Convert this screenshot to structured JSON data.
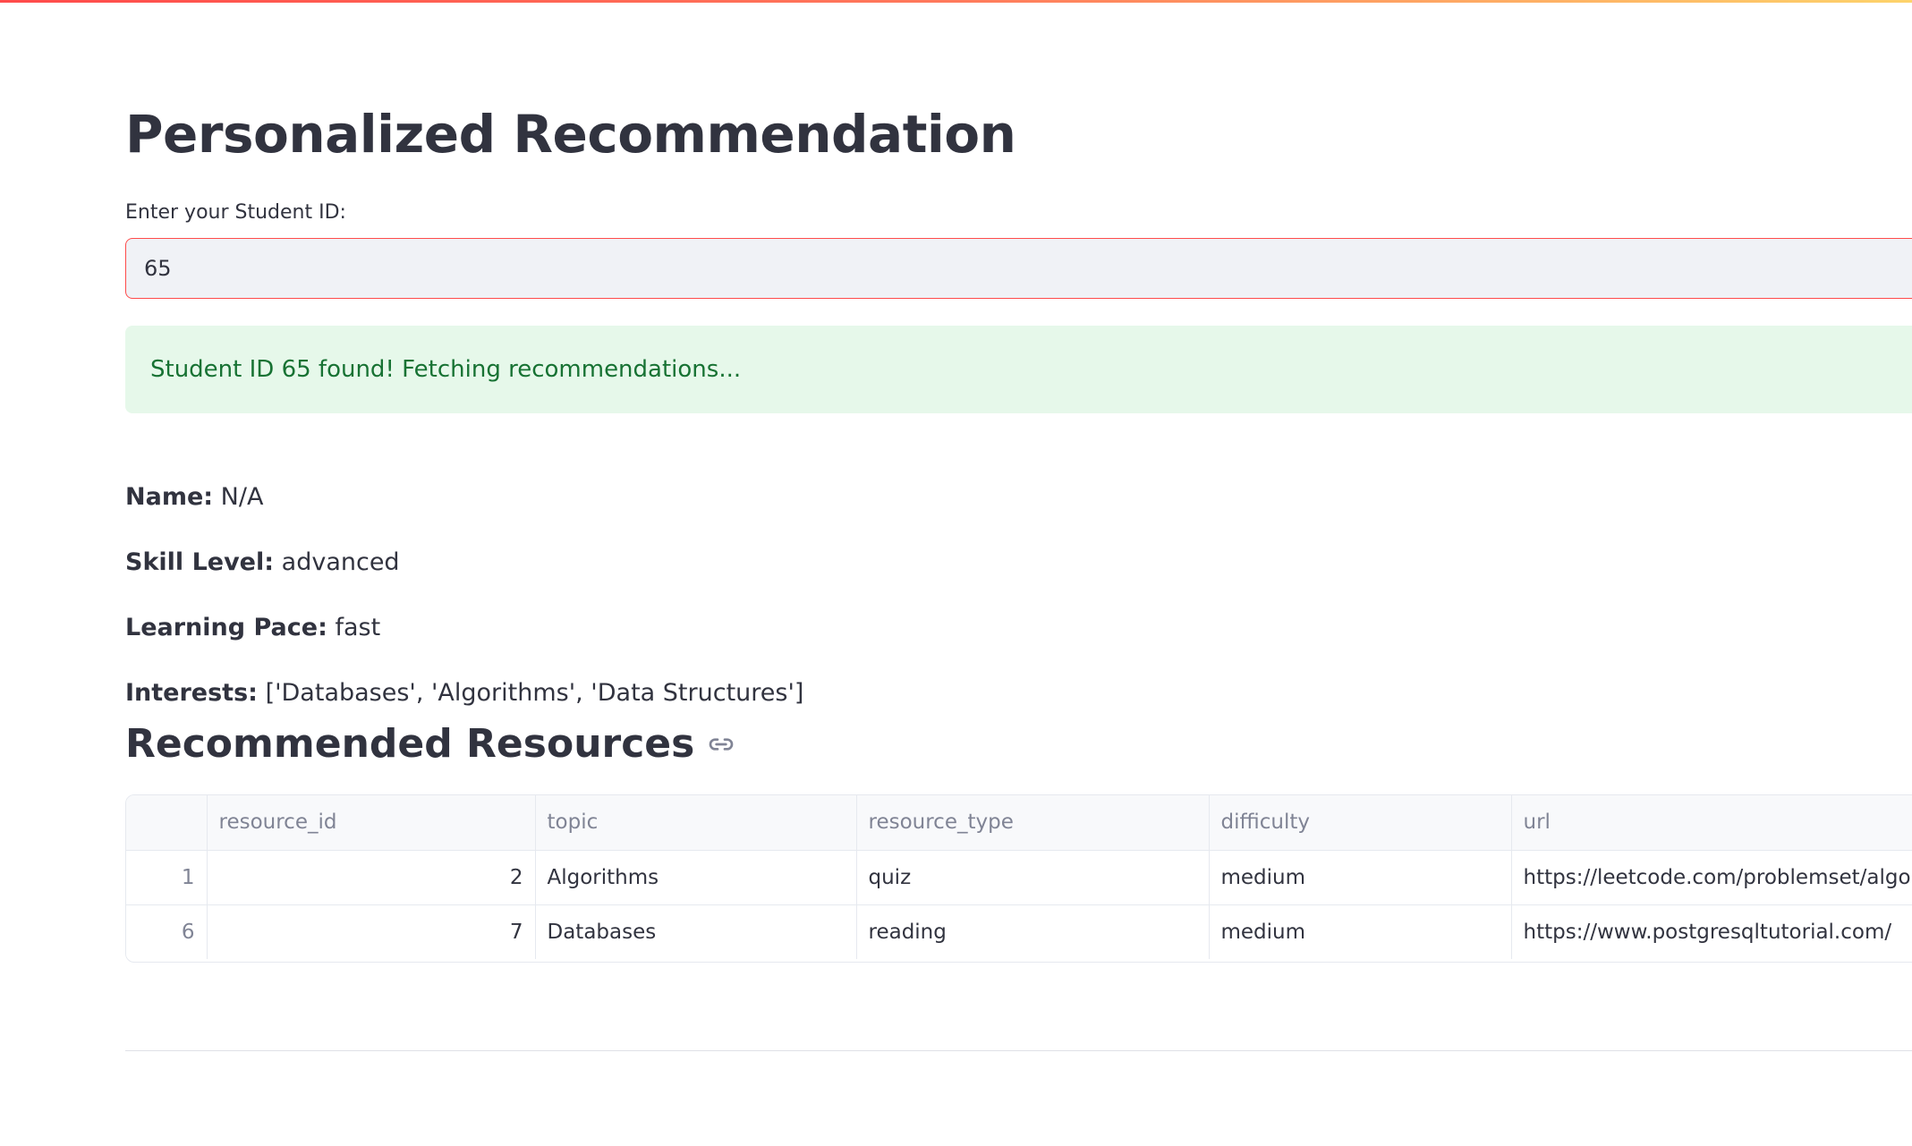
{
  "header": {
    "title": "Personalized Recommendation"
  },
  "student_input": {
    "label": "Enter your Student ID:",
    "value": "65"
  },
  "status": {
    "message": "Student ID 65 found! Fetching recommendations...",
    "color": "#177233",
    "background": "#e6f8ea"
  },
  "profile": {
    "name_label": "Name:",
    "name_value": "N/A",
    "skill_label": "Skill Level:",
    "skill_value": "advanced",
    "pace_label": "Learning Pace:",
    "pace_value": "fast",
    "interests_label": "Interests:",
    "interests_value": "['Databases', 'Algorithms', 'Data Structures']"
  },
  "resources": {
    "title": "Recommended Resources",
    "anchor_icon": "link-icon",
    "columns": [
      "",
      "resource_id",
      "topic",
      "resource_type",
      "difficulty",
      "url"
    ],
    "rows": [
      {
        "index": "1",
        "resource_id": "2",
        "topic": "Algorithms",
        "resource_type": "quiz",
        "difficulty": "medium",
        "url": "https://leetcode.com/problemset/algorithms/"
      },
      {
        "index": "6",
        "resource_id": "7",
        "topic": "Databases",
        "resource_type": "reading",
        "difficulty": "medium",
        "url": "https://www.postgresqltutorial.com/"
      }
    ]
  },
  "theme": {
    "accent": "#ff4b4b",
    "text": "#31333f",
    "muted": "#808495"
  }
}
